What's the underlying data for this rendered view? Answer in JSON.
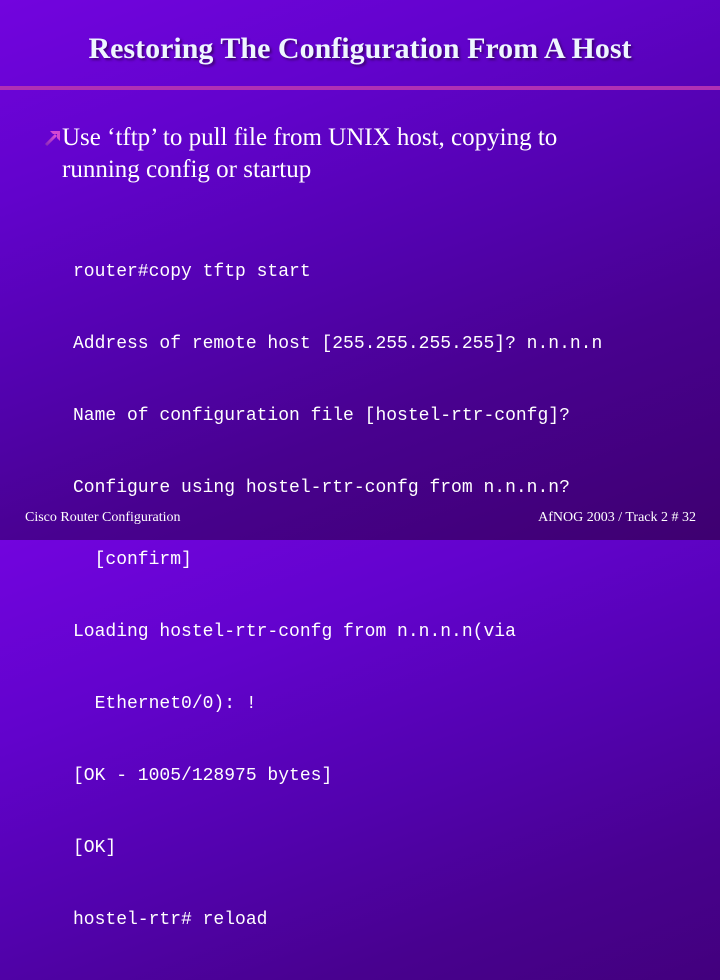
{
  "slide": {
    "title": "Restoring The Configuration From A Host",
    "bullet": {
      "icon": "arrow-up-right-icon",
      "text": "Use ‘tftp’ to pull file from UNIX host, copying to\nrunning config or startup"
    },
    "code_lines": [
      "router#copy tftp start",
      "Address of remote host [255.255.255.255]? n.n.n.n",
      "Name of configuration file [hostel-rtr-confg]?",
      "Configure using hostel-rtr-confg from n.n.n.n?",
      "  [confirm]",
      "Loading hostel-rtr-confg from n.n.n.n(via",
      "  Ethernet0/0): !",
      "[OK - 1005/128975 bytes]",
      "[OK]",
      "hostel-rtr# reload"
    ],
    "footer": {
      "left": "Cisco Router Configuration",
      "right": "AfNOG 2003 / Track 2  # 32"
    }
  },
  "colors": {
    "background_top_left": "#7204de",
    "background_bottom_right": "#3e0070",
    "divider": "#b030b4",
    "bullet_icon": "#c040c8",
    "text": "#ffffff"
  }
}
